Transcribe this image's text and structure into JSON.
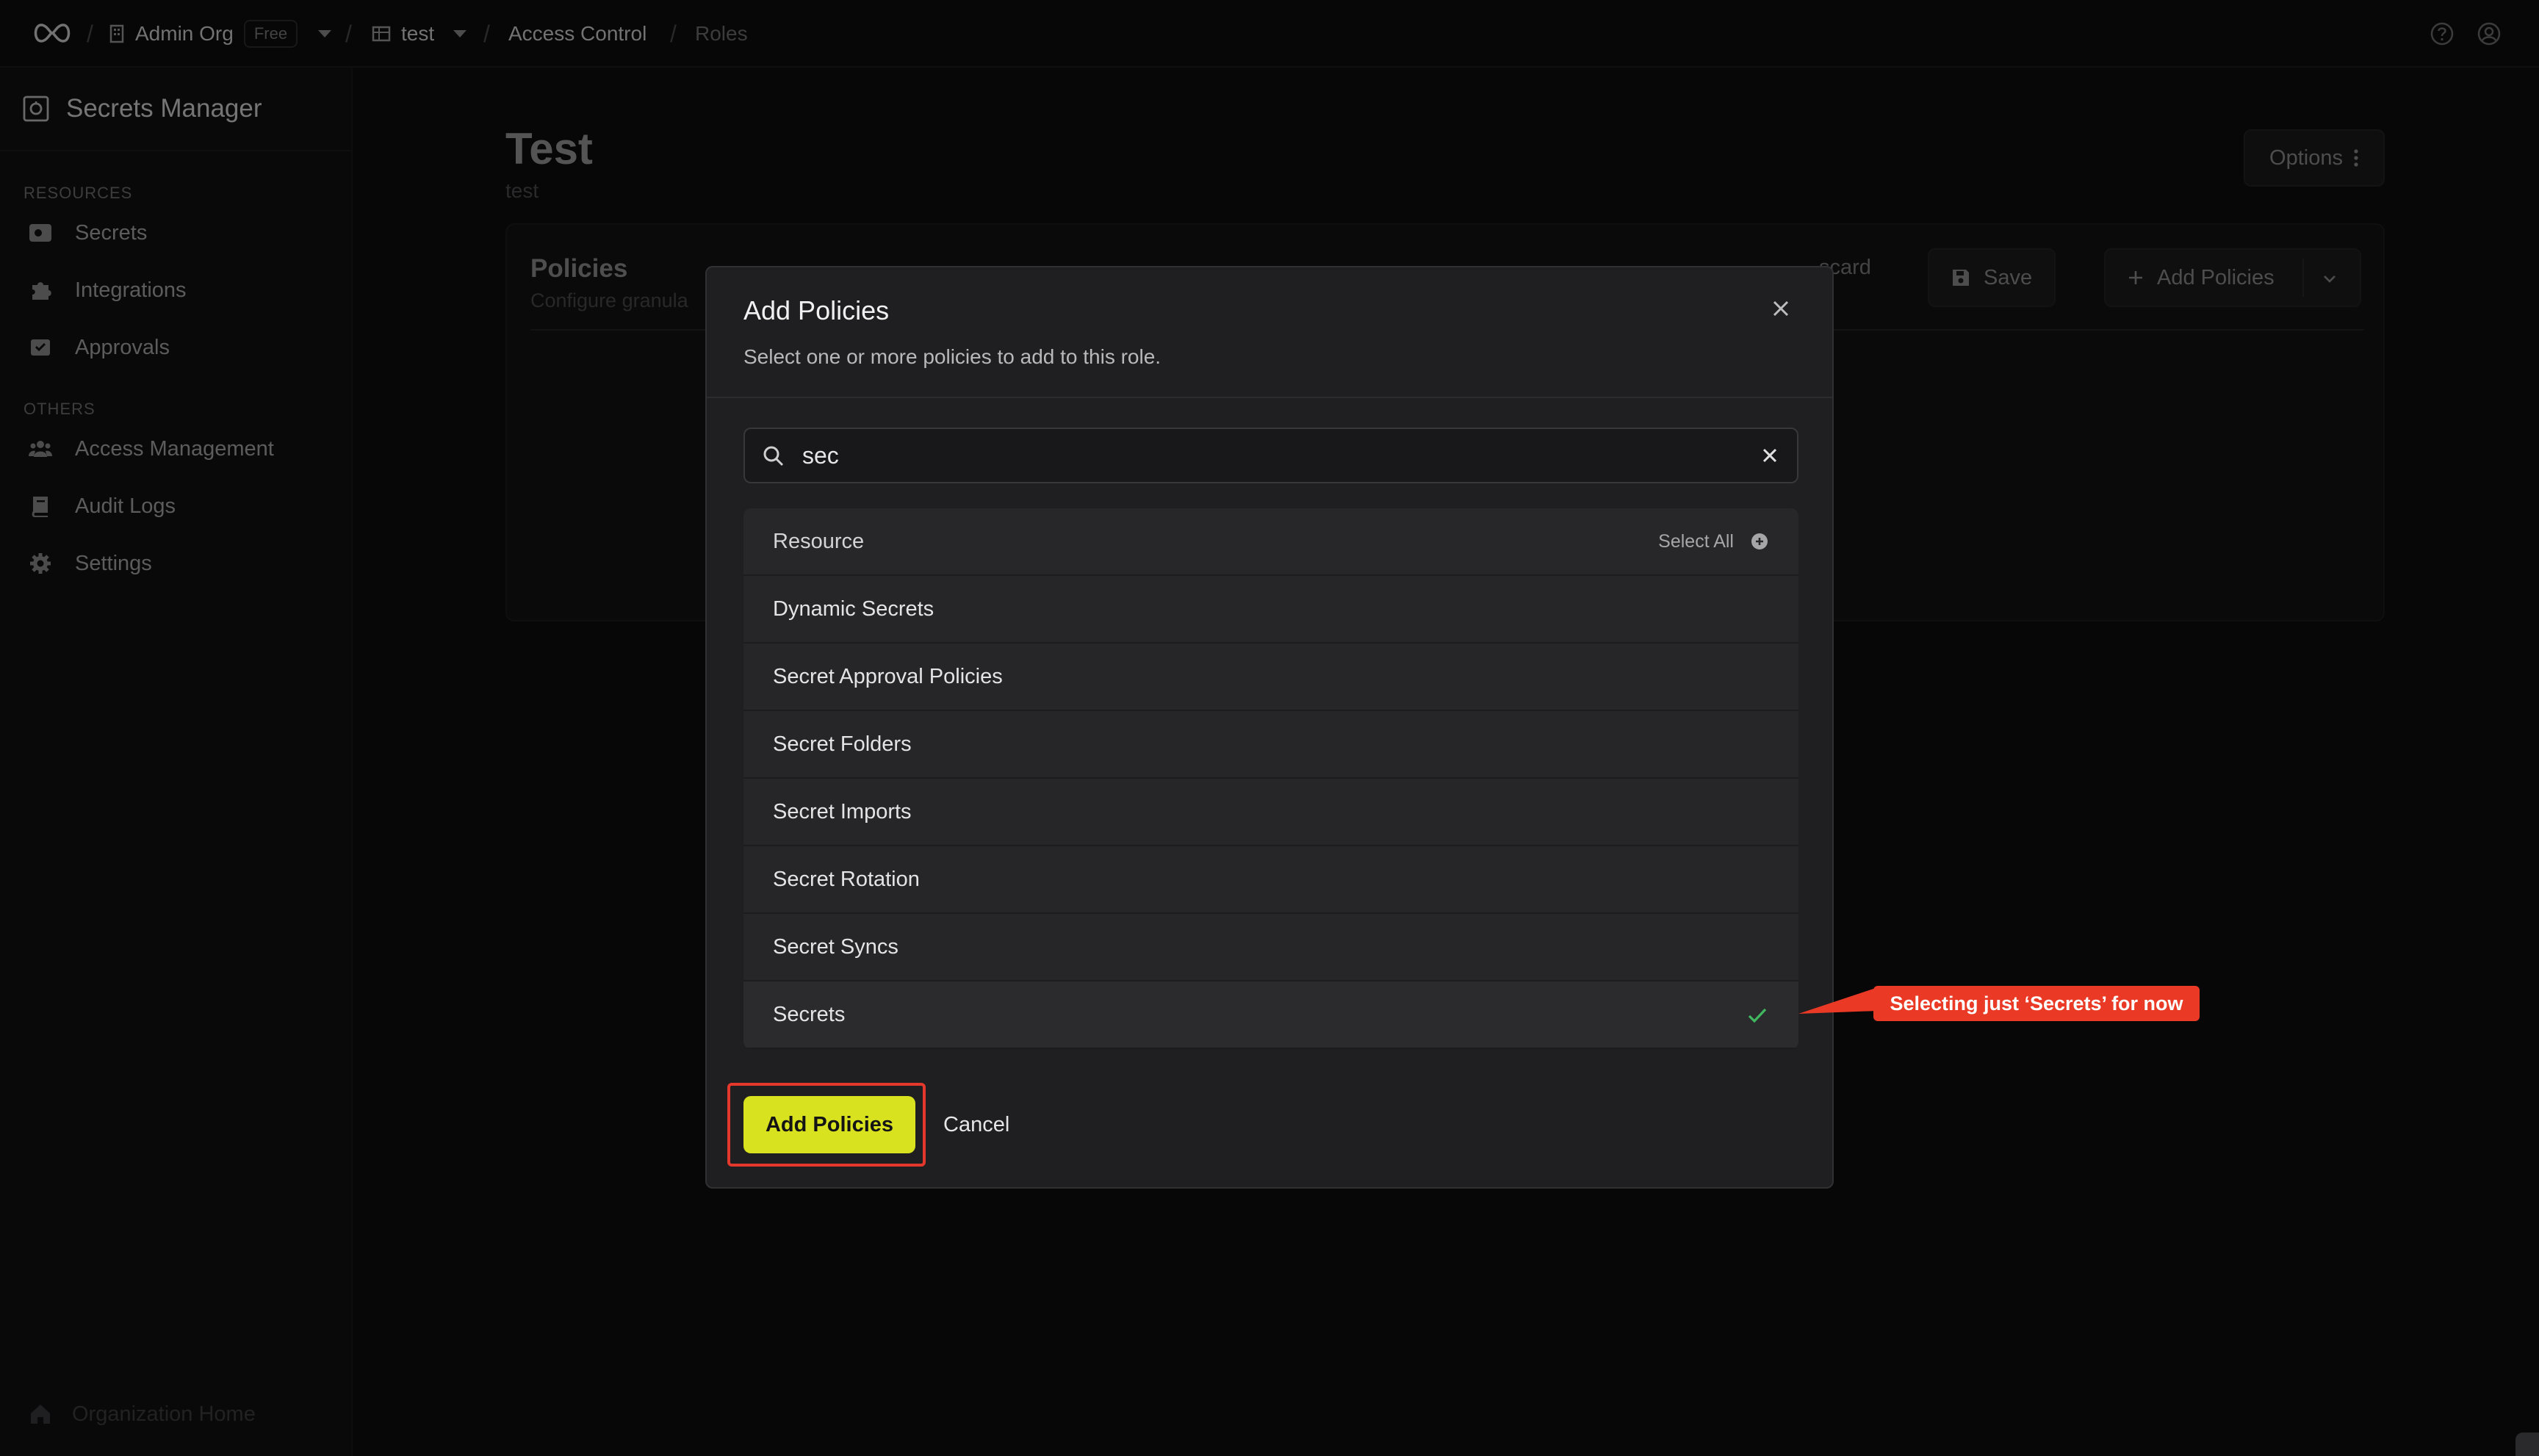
{
  "topbar": {
    "org_name": "Admin Org",
    "plan_badge": "Free",
    "project_name": "test",
    "section": "Access Control",
    "page": "Roles",
    "separator": "/"
  },
  "sidebar": {
    "title": "Secrets Manager",
    "resources_label": "RESOURCES",
    "resources": [
      "Secrets",
      "Integrations",
      "Approvals"
    ],
    "others_label": "OTHERS",
    "others": [
      "Access Management",
      "Audit Logs",
      "Settings"
    ],
    "footer": "Organization Home"
  },
  "page": {
    "title": "Test",
    "subtitle": "test",
    "options_label": "Options"
  },
  "policies_card": {
    "title": "Policies",
    "subtitle": "Configure granula",
    "discard_label": "scard",
    "save_label": "Save",
    "add_label": "Add Policies"
  },
  "modal": {
    "title": "Add Policies",
    "subtitle": "Select one or more policies to add to this role.",
    "search_value": "sec",
    "header_label": "Resource",
    "select_all_label": "Select All",
    "items": [
      {
        "label": "Dynamic Secrets",
        "selected": false
      },
      {
        "label": "Secret Approval Policies",
        "selected": false
      },
      {
        "label": "Secret Folders",
        "selected": false
      },
      {
        "label": "Secret Imports",
        "selected": false
      },
      {
        "label": "Secret Rotation",
        "selected": false
      },
      {
        "label": "Secret Syncs",
        "selected": false
      },
      {
        "label": "Secrets",
        "selected": true
      }
    ],
    "add_button_label": "Add Policies",
    "cancel_label": "Cancel"
  },
  "annotation": {
    "callout_text": "Selecting just ‘Secrets’ for now"
  },
  "colors": {
    "accent": "#d9e21f",
    "callout": "#ea3a26",
    "check": "#3fb85f"
  }
}
